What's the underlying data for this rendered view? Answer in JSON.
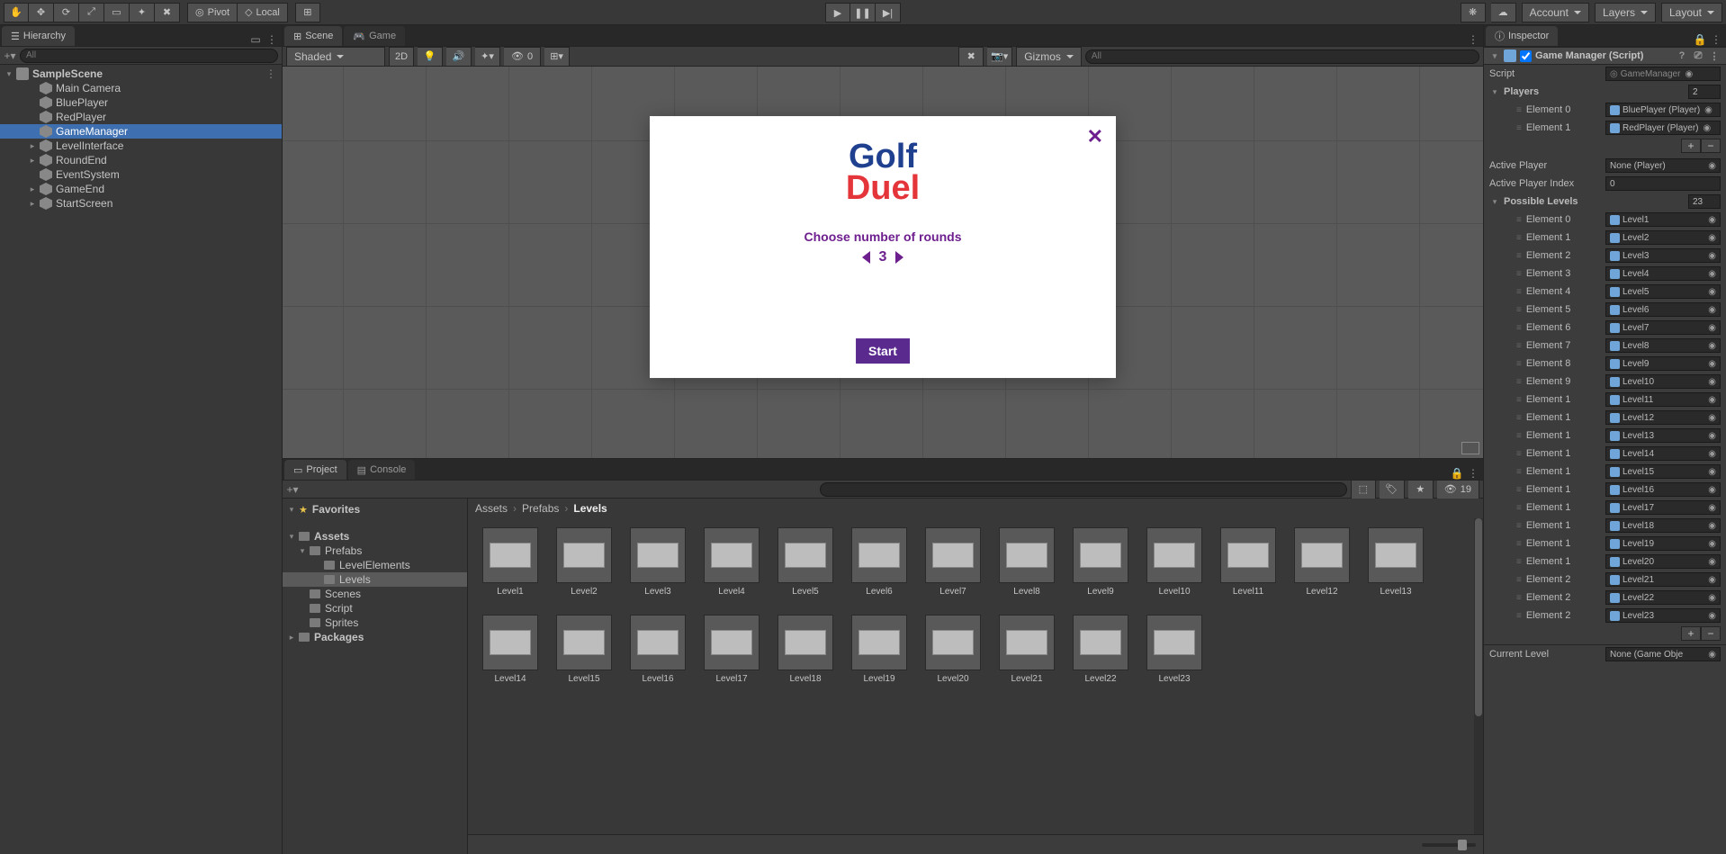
{
  "toolbar": {
    "pivot": "Pivot",
    "local": "Local",
    "account": "Account",
    "layers": "Layers",
    "layout": "Layout"
  },
  "hierarchy": {
    "title": "Hierarchy",
    "search_placeholder": "All",
    "scene": "SampleScene",
    "items": [
      "Main Camera",
      "BluePlayer",
      "RedPlayer",
      "GameManager",
      "LevelInterface",
      "RoundEnd",
      "EventSystem",
      "GameEnd",
      "StartScreen"
    ],
    "selected": "GameManager",
    "expandable": [
      "LevelInterface",
      "RoundEnd",
      "GameEnd",
      "StartScreen"
    ]
  },
  "scene": {
    "tab_scene": "Scene",
    "tab_game": "Game",
    "shaded": "Shaded",
    "two_d": "2D",
    "gizmos": "Gizmos",
    "search_placeholder": "All",
    "hidden_count": "0"
  },
  "game_ui": {
    "title1": "Golf",
    "title2": "Duel",
    "choose": "Choose number of rounds",
    "rounds": "3",
    "start": "Start",
    "close": "✕"
  },
  "project": {
    "tab_project": "Project",
    "tab_console": "Console",
    "hidden_count": "19",
    "breadcrumb": [
      "Assets",
      "Prefabs",
      "Levels"
    ],
    "favorites": "Favorites",
    "tree": {
      "assets": "Assets",
      "prefabs": "Prefabs",
      "level_elements": "LevelElements",
      "levels": "Levels",
      "scenes": "Scenes",
      "script": "Script",
      "sprites": "Sprites",
      "packages": "Packages"
    },
    "assets": [
      "Level1",
      "Level2",
      "Level3",
      "Level4",
      "Level5",
      "Level6",
      "Level7",
      "Level8",
      "Level9",
      "Level10",
      "Level11",
      "Level12",
      "Level13",
      "Level14",
      "Level15",
      "Level16",
      "Level17",
      "Level18",
      "Level19",
      "Level20",
      "Level21",
      "Level22",
      "Level23"
    ]
  },
  "inspector": {
    "title": "Inspector",
    "component": "Game Manager (Script)",
    "script_label": "Script",
    "script_value": "GameManager",
    "players_label": "Players",
    "players_count": "2",
    "player_el0_label": "Element 0",
    "player_el0_value": "BluePlayer (Player)",
    "player_el1_label": "Element 1",
    "player_el1_value": "RedPlayer (Player)",
    "active_player_label": "Active Player",
    "active_player_value": "None (Player)",
    "active_index_label": "Active Player Index",
    "active_index_value": "0",
    "levels_label": "Possible Levels",
    "levels_count": "23",
    "level_items": [
      "Level1",
      "Level2",
      "Level3",
      "Level4",
      "Level5",
      "Level6",
      "Level7",
      "Level8",
      "Level9",
      "Level10",
      "Level11",
      "Level12",
      "Level13",
      "Level14",
      "Level15",
      "Level16",
      "Level17",
      "Level18",
      "Level19",
      "Level20",
      "Level21",
      "Level22",
      "Level23"
    ],
    "current_level_label": "Current Level",
    "current_level_value": "None (Game Obje"
  }
}
